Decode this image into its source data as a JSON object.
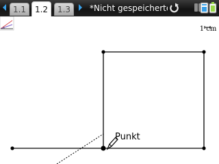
{
  "tabs": [
    {
      "label": "1.1",
      "active": false
    },
    {
      "label": "1.2",
      "active": true
    },
    {
      "label": "1.3",
      "active": false
    }
  ],
  "document_title": "*Nicht gespeicherte",
  "scale": {
    "label": "1 cm"
  },
  "point": {
    "label": "Punkt"
  },
  "icons": [
    "tab-prev-icon",
    "tab-next-icon",
    "refresh-icon",
    "document-tools-icon",
    "graphs-menu-icon",
    "pencil-icon"
  ],
  "colors": {
    "accent": "#39a0e8",
    "bar": "#1a1a1a"
  }
}
